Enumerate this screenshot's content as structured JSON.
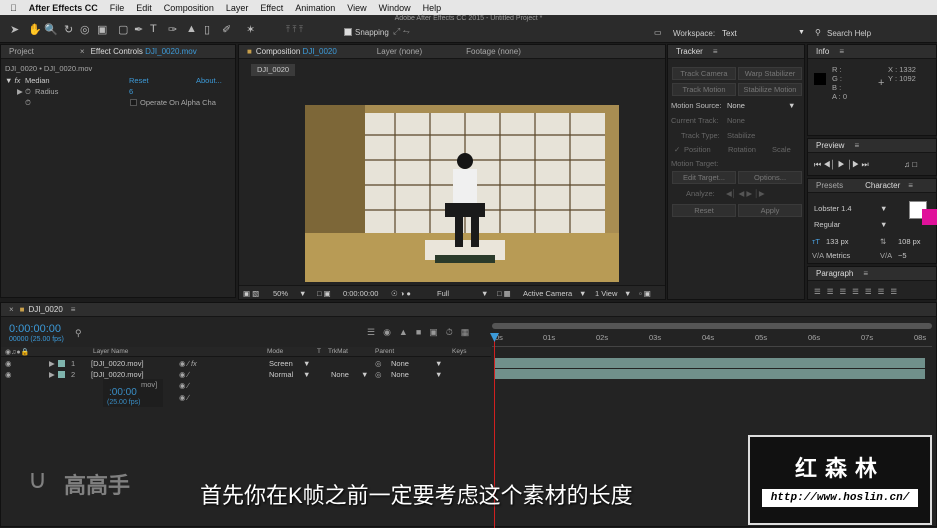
{
  "menubar": {
    "app": "After Effects CC",
    "items": [
      "File",
      "Edit",
      "Composition",
      "Layer",
      "Effect",
      "Animation",
      "View",
      "Window",
      "Help"
    ]
  },
  "window_title": "Adobe After Effects CC 2015 - Untitled Project *",
  "toolbar": {
    "snapping": "Snapping",
    "workspace_label": "Workspace:",
    "workspace_value": "Text",
    "search_placeholder": "Search Help"
  },
  "left_panel": {
    "tab_project": "Project",
    "tab_effects": "Effect Controls",
    "tab_effects_file": "DJI_0020.mov",
    "breadcrumb": "DJI_0020 • DJI_0020.mov",
    "effect_name": "Median",
    "reset": "Reset",
    "about": "About...",
    "radius_label": "Radius",
    "radius_value": "6",
    "operate_label": "Operate On Alpha Cha"
  },
  "comp_panel": {
    "tab": "Composition",
    "tab_name": "DJI_0020",
    "layer_tab": "Layer (none)",
    "footage_tab": "Footage (none)",
    "comp_chip": "DJI_0020",
    "zoom": "50%",
    "timecode": "0:00:00:00",
    "resolution": "Full",
    "camera": "Active Camera",
    "view": "1 View"
  },
  "tracker": {
    "title": "Tracker",
    "track_camera": "Track Camera",
    "warp_stabilizer": "Warp Stabilizer",
    "track_motion": "Track Motion",
    "stabilize_motion": "Stabilize Motion",
    "motion_source_label": "Motion Source:",
    "motion_source_value": "None",
    "current_track_label": "Current Track:",
    "current_track_value": "None",
    "track_type_label": "Track Type:",
    "track_type_value": "Stabilize",
    "position": "Position",
    "rotation": "Rotation",
    "scale": "Scale",
    "motion_target": "Motion Target:",
    "edit_target": "Edit Target...",
    "options": "Options...",
    "analyze": "Analyze:",
    "reset": "Reset",
    "apply": "Apply"
  },
  "info": {
    "title": "Info",
    "r": "R :",
    "g": "G :",
    "b": "B :",
    "a": "A : 0",
    "x": "X : 1332",
    "y": "Y : 1092"
  },
  "preview": {
    "title": "Preview"
  },
  "character": {
    "tab_presets": "Presets",
    "tab_character": "Character",
    "font": "Lobster 1.4",
    "style": "Regular",
    "size": "133 px",
    "leading": "108 px",
    "kerning": "Metrics",
    "tracking": "−5",
    "fill_color": "#ffffff",
    "stroke_color": "#e0119a"
  },
  "paragraph": {
    "title": "Paragraph"
  },
  "timeline": {
    "tab": "DJI_0020",
    "timecode": "0:00:00:00",
    "fps": "00000 (25.00 fps)",
    "cols": {
      "layer_name": "Layer Name",
      "mode": "Mode",
      "t": "T",
      "trkmat": "TrkMat",
      "parent": "Parent",
      "keys": "Keys"
    },
    "layers": [
      {
        "num": "1",
        "name": "[DJI_0020.mov]",
        "mode": "Screen",
        "trkmat": "",
        "parent": "None"
      },
      {
        "num": "2",
        "name": "[DJI_0020.mov]",
        "mode": "Normal",
        "trkmat": "None",
        "parent": "None"
      }
    ],
    "ghost_timecode": ":00:00",
    "ghost_fps": "(25.00 fps)",
    "ghost_name": "mov]",
    "ruler": [
      "01s",
      "02s",
      "03s",
      "04s",
      "05s",
      "06s",
      "07s",
      "08s"
    ],
    "ruler_start": "0s"
  },
  "overlay": {
    "subtitle": "首先你在K帧之前一定要考虑这个素材的长度",
    "watermark_name": "高高手",
    "badge_title": "红森林",
    "badge_url": "http://www.hoslin.cn/"
  }
}
